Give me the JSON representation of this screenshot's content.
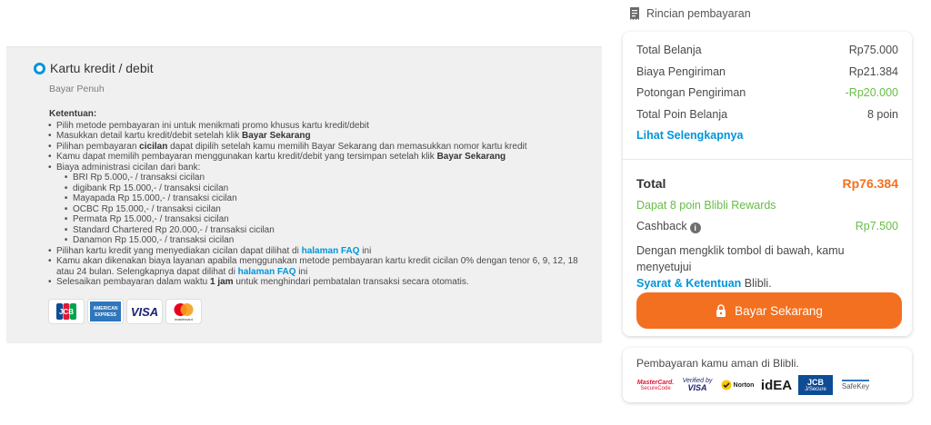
{
  "payment_method": {
    "name": "Kartu kredit / debit",
    "subtitle": "Bayar Penuh",
    "terms_heading": "Ketentuan:",
    "terms": [
      [
        "Pilih metode pembayaran ini untuk menikmati promo khusus kartu kredit/debit"
      ],
      [
        "Masukkan detail kartu kredit/debit setelah klik ",
        "Bayar Sekarang"
      ],
      [
        "Pilihan pembayaran ",
        "cicilan",
        " dapat dipilih setelah kamu memilih Bayar Sekarang dan memasukkan nomor kartu kredit"
      ],
      [
        "Kamu dapat memilih pembayaran menggunakan kartu kredit/debit yang tersimpan setelah klik ",
        "Bayar Sekarang"
      ],
      [
        "Biaya administrasi cicilan dari bank:"
      ],
      [
        "Pilihan kartu kredit yang menyediakan cicilan dapat dilihat di ",
        "halaman FAQ",
        " ini"
      ],
      [
        "Kamu akan dikenakan biaya layanan apabila menggunakan metode pembayaran kartu kredit cicilan 0% dengan tenor 6, 9, 12, 18 atau 24 bulan. Selengkapnya dapat dilihat di ",
        "halaman FAQ",
        " ini"
      ],
      [
        "Selesaikan pembayaran dalam waktu ",
        "1 jam",
        " untuk menghindari pembatalan transaksi secara otomatis."
      ]
    ],
    "bank_fees": [
      "BRI Rp 5.000,- / transaksi cicilan",
      "digibank Rp 15.000,- / transaksi cicilan",
      "Mayapada Rp 15.000,- / transaksi cicilan",
      "OCBC Rp 15.000,- / transaksi cicilan",
      "Permata Rp 15.000,- / transaksi cicilan",
      "Standard Chartered Rp 20.000,- / transaksi cicilan",
      "Danamon Rp 15.000,- / transaksi cicilan"
    ],
    "card_logos": {
      "jcb": "JCB",
      "amex_1": "AMERICAN",
      "amex_2": "EXPRESS",
      "visa": "VISA",
      "mastercard": "mastercard"
    }
  },
  "summary": {
    "heading": "Rincian pembayaran",
    "rows": [
      {
        "label": "Total Belanja",
        "value": "Rp75.000"
      },
      {
        "label": "Biaya Pengiriman",
        "value": "Rp21.384"
      },
      {
        "label": "Potongan Pengiriman",
        "value": "-Rp20.000"
      },
      {
        "label": "Total Poin Belanja",
        "value": "8 poin"
      }
    ],
    "see_more": "Lihat Selengkapnya",
    "total_label": "Total",
    "total_value": "Rp76.384",
    "rewards": "Dapat 8 poin Blibli Rewards",
    "cashback_label": "Cashback",
    "cashback_value": "Rp7.500",
    "agree_text": "Dengan mengklik tombol di bawah, kamu menyetujui",
    "agree_link": "Syarat & Ketentuan",
    "agree_suffix": "Blibli.",
    "pay_button": "Bayar Sekarang"
  },
  "secure": {
    "text": "Pembayaran kamu aman di Blibli.",
    "logos": {
      "mastercard_1": "MasterCard.",
      "mastercard_2": "SecureCode",
      "visa_1": "Verified by",
      "visa_2": "VISA",
      "norton": "Norton",
      "idea": "idEA",
      "jcb_1": "JCB",
      "jcb_2": "J/Secure",
      "safekey": "SafeKey"
    }
  },
  "colors": {
    "accent_orange": "#f37021",
    "link_blue": "#0095da",
    "positive_green": "#67bd46"
  }
}
